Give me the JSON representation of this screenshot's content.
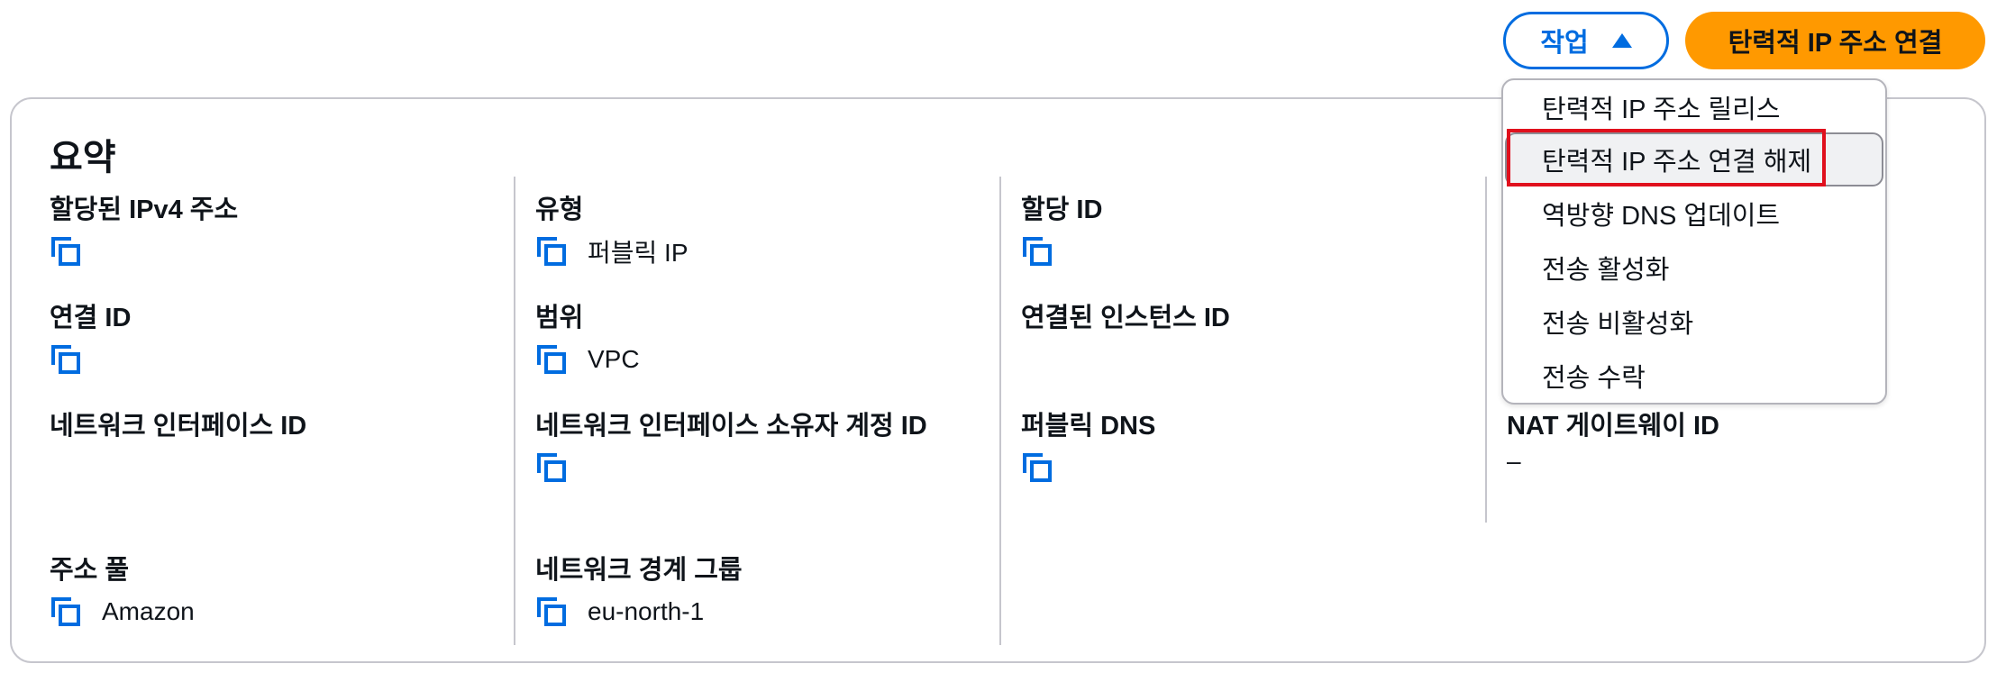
{
  "toolbar": {
    "actions_label": "작업",
    "primary_label": "탄력적 IP 주소 연결"
  },
  "summary": {
    "title": "요약",
    "fields": [
      {
        "label": "할당된 IPv4 주소",
        "value": ""
      },
      {
        "label": "유형",
        "value": "퍼블릭 IP"
      },
      {
        "label": "할당 ID",
        "value": ""
      },
      {
        "label": "연결 ID",
        "value": ""
      },
      {
        "label": "범위",
        "value": "VPC"
      },
      {
        "label": "연결된 인스턴스 ID",
        "value": ""
      },
      {
        "label": "네트워크 인터페이스 ID",
        "value": ""
      },
      {
        "label": "네트워크 인터페이스 소유자 계정 ID",
        "value": ""
      },
      {
        "label": "퍼블릭 DNS",
        "value": ""
      },
      {
        "label": "NAT 게이트웨이 ID",
        "value": "–"
      },
      {
        "label": "주소 풀",
        "value": "Amazon"
      },
      {
        "label": "네트워크 경계 그룹",
        "value": "eu-north-1"
      }
    ]
  },
  "actions_menu": {
    "items": [
      {
        "label": "탄력적 IP 주소 릴리스"
      },
      {
        "label": "탄력적 IP 주소 연결 해제"
      },
      {
        "label": "역방향 DNS 업데이트"
      },
      {
        "label": "전송 활성화"
      },
      {
        "label": "전송 비활성화"
      },
      {
        "label": "전송 수락"
      }
    ]
  },
  "colors": {
    "accent": "#006ce0",
    "primary_button": "#ff9900",
    "highlight": "#e0101d",
    "border": "#c6c6cd"
  },
  "icons": [
    "copy-icon",
    "caret-up-icon"
  ]
}
